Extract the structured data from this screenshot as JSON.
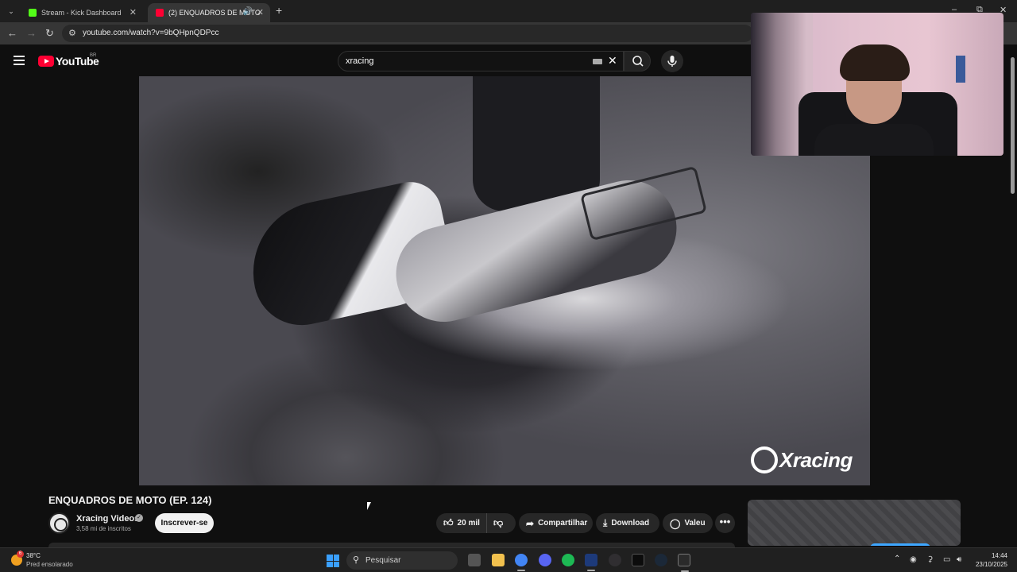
{
  "browser": {
    "tabs": [
      {
        "title": "Stream - Kick Dashboard",
        "icon": "kick-icon",
        "color": "#53fc18"
      },
      {
        "title": "(2) ENQUADROS DE MOTO",
        "icon": "youtube-icon",
        "color": "#ff0033"
      }
    ],
    "url": "youtube.com/watch?v=9bQHpnQDPcc"
  },
  "youtube": {
    "logo_text": "YouTube",
    "country": "BR",
    "search_value": "xracing"
  },
  "video": {
    "watermark": "Xracing",
    "title": "ENQUADROS DE MOTO (EP. 124)",
    "channel": "Xracing Videos",
    "subscribers": "3,58 mi de inscritos",
    "subscribe_label": "Inscrever-se",
    "likes": "20 mil",
    "share_label": "Compartilhar",
    "download_label": "Download",
    "thanks_label": "Valeu",
    "more_label": "•••"
  },
  "taskbar": {
    "temperature": "38°C",
    "weather": "Pred ensolarado",
    "weather_badge": "6",
    "search_placeholder": "Pesquisar",
    "time": "14:44",
    "date": "23/10/2025",
    "apps": [
      {
        "name": "file-explorer",
        "color": "#f2c14e"
      },
      {
        "name": "task-view",
        "color": "#555555"
      },
      {
        "name": "chrome",
        "color": "#4285f4"
      },
      {
        "name": "discord",
        "color": "#5865f2"
      },
      {
        "name": "spotify",
        "color": "#1db954"
      },
      {
        "name": "app-blue",
        "color": "#1d3a7a"
      },
      {
        "name": "obs",
        "color": "#302e31"
      },
      {
        "name": "terminal",
        "color": "#0c0c0c"
      },
      {
        "name": "steam",
        "color": "#1b2838"
      },
      {
        "name": "epic-games",
        "color": "#2a2a2a"
      }
    ]
  }
}
